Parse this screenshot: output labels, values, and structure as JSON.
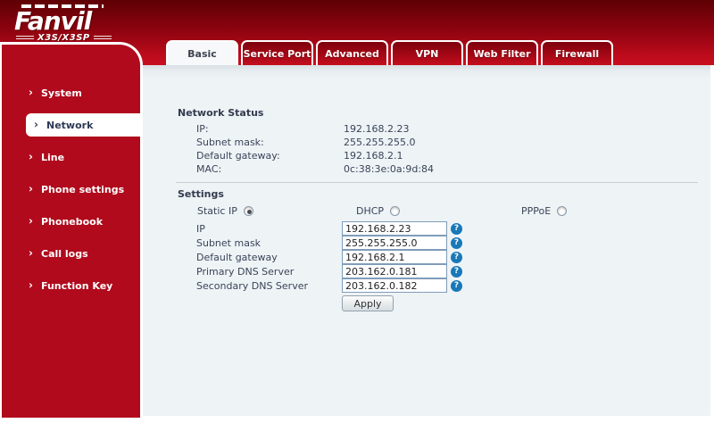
{
  "logo": {
    "brand": "Fanvil",
    "model": "X3S/X3SP"
  },
  "tabs": [
    {
      "label": "Basic",
      "active": true
    },
    {
      "label": "Service Port",
      "active": false
    },
    {
      "label": "Advanced",
      "active": false
    },
    {
      "label": "VPN",
      "active": false
    },
    {
      "label": "Web Filter",
      "active": false
    },
    {
      "label": "Firewall",
      "active": false
    }
  ],
  "sidebar": {
    "items": [
      {
        "label": "System",
        "active": false
      },
      {
        "label": "Network",
        "active": true
      },
      {
        "label": "Line",
        "active": false
      },
      {
        "label": "Phone settings",
        "active": false
      },
      {
        "label": "Phonebook",
        "active": false
      },
      {
        "label": "Call logs",
        "active": false
      },
      {
        "label": "Function Key",
        "active": false
      }
    ]
  },
  "network_status": {
    "title": "Network Status",
    "rows": [
      {
        "label": "IP:",
        "value": "192.168.2.23"
      },
      {
        "label": "Subnet mask:",
        "value": "255.255.255.0"
      },
      {
        "label": "Default gateway:",
        "value": "192.168.2.1"
      },
      {
        "label": "MAC:",
        "value": "0c:38:3e:0a:9d:84"
      }
    ]
  },
  "settings": {
    "title": "Settings",
    "modes": [
      {
        "label": "Static IP",
        "selected": true
      },
      {
        "label": "DHCP",
        "selected": false
      },
      {
        "label": "PPPoE",
        "selected": false
      }
    ],
    "fields": [
      {
        "label": "IP",
        "value": "192.168.2.23"
      },
      {
        "label": "Subnet mask",
        "value": "255.255.255.0"
      },
      {
        "label": "Default gateway",
        "value": "192.168.2.1"
      },
      {
        "label": "Primary DNS Server",
        "value": "203.162.0.181"
      },
      {
        "label": "Secondary DNS Server",
        "value": "203.162.0.182"
      }
    ],
    "apply_label": "Apply"
  },
  "colors": {
    "brand_red": "#b00a1c",
    "header_gradient_top": "#5e0005",
    "header_gradient_bottom": "#c90f20",
    "content_background": "#eef3f6",
    "help_icon_blue": "#1878b8",
    "text_dark": "#3a4458"
  }
}
